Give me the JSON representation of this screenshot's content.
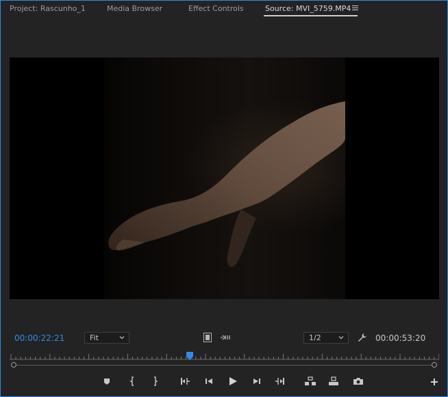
{
  "tabs": [
    {
      "label": "Project: Rascunho_1"
    },
    {
      "label": "Media Browser"
    },
    {
      "label": "Effect Controls"
    },
    {
      "label": "Source: MVI_5759.MP4"
    }
  ],
  "monitor": {
    "current_time": "00:00:22:21",
    "duration": "00:00:53:20",
    "zoom_select": "Fit",
    "resolution_select": "1/2"
  },
  "playhead_fraction": 0.42,
  "colors": {
    "accent": "#2d8ceb",
    "panel_bg": "#232323"
  },
  "icons": {
    "tab_menu": "panel-menu-icon",
    "settings": "wrench-icon",
    "transport": [
      "add-marker-icon",
      "mark-in-icon",
      "mark-out-icon",
      "go-to-in-icon",
      "step-back-icon",
      "play-icon",
      "step-forward-icon",
      "go-to-out-icon",
      "insert-icon",
      "overwrite-icon",
      "export-frame-icon",
      "button-editor-icon"
    ]
  }
}
